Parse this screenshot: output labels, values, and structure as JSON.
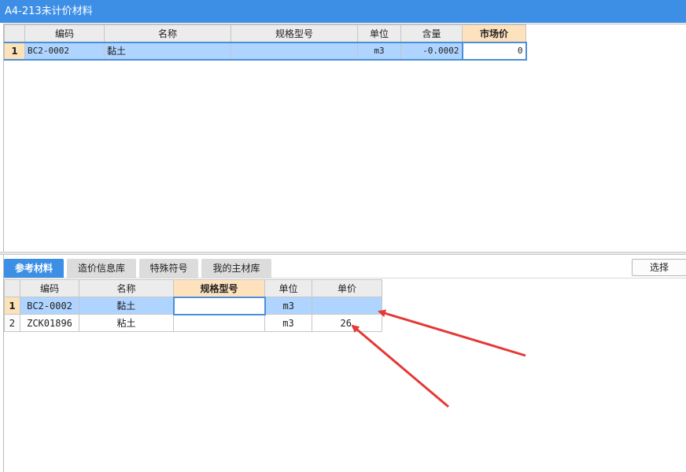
{
  "window": {
    "title": "A4-213未计价材料"
  },
  "top_grid": {
    "columns": [
      "编码",
      "名称",
      "规格型号",
      "单位",
      "含量",
      "市场价"
    ],
    "rows": [
      {
        "num": "1",
        "code": "BC2-0002",
        "name": "黏土",
        "spec": "",
        "unit": "m3",
        "amount": "-0.0002",
        "price": "0"
      }
    ]
  },
  "tabs": [
    {
      "label": "参考材料",
      "active": true
    },
    {
      "label": "造价信息库",
      "active": false
    },
    {
      "label": "特殊符号",
      "active": false
    },
    {
      "label": "我的主材库",
      "active": false
    }
  ],
  "select_button": {
    "label": "选择"
  },
  "bottom_grid": {
    "columns": [
      "编码",
      "名称",
      "规格型号",
      "单位",
      "单价"
    ],
    "rows": [
      {
        "num": "1",
        "code": "BC2-0002",
        "name": "黏土",
        "spec": "",
        "unit": "m3",
        "price": ""
      },
      {
        "num": "2",
        "code": "ZCK01896",
        "name": "粘土",
        "spec": "",
        "unit": "m3",
        "price": "26"
      }
    ]
  },
  "colors": {
    "accent": "#3d8fe6",
    "selection": "#aed4ff",
    "highlight_header": "#fde2bd",
    "annotation": "#e53935"
  }
}
